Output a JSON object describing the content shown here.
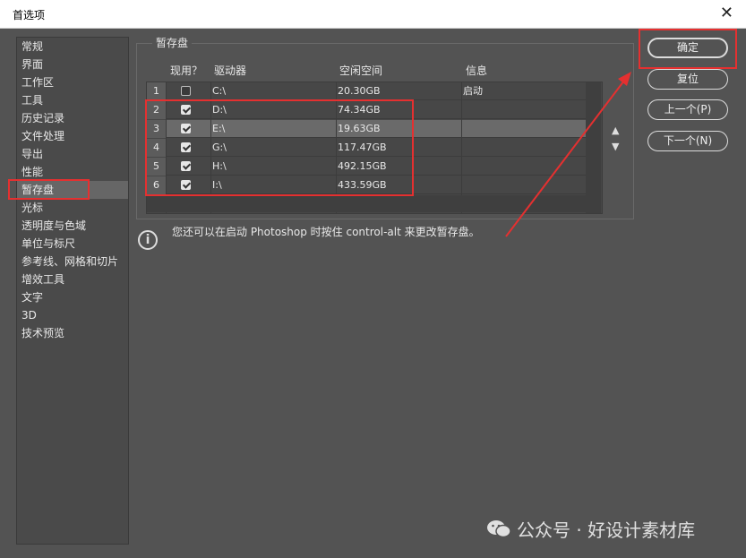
{
  "window": {
    "title": "首选项"
  },
  "sidebar": {
    "items": [
      {
        "label": "常规"
      },
      {
        "label": "界面"
      },
      {
        "label": "工作区"
      },
      {
        "label": "工具"
      },
      {
        "label": "历史记录"
      },
      {
        "label": "文件处理"
      },
      {
        "label": "导出"
      },
      {
        "label": "性能"
      },
      {
        "label": "暂存盘",
        "active": true
      },
      {
        "label": "光标"
      },
      {
        "label": "透明度与色域"
      },
      {
        "label": "单位与标尺"
      },
      {
        "label": "参考线、网格和切片"
      },
      {
        "label": "增效工具"
      },
      {
        "label": "文字"
      },
      {
        "label": "3D"
      },
      {
        "label": "技术预览"
      }
    ]
  },
  "scratch": {
    "group_title": "暂存盘",
    "columns": {
      "active": "现用？",
      "drive": "驱动器",
      "free": "空闲空间",
      "info": "信息"
    },
    "rows": [
      {
        "num": "1",
        "checked": false,
        "drive": "C:\\",
        "free": "20.30GB",
        "info": "启动"
      },
      {
        "num": "2",
        "checked": true,
        "drive": "D:\\",
        "free": "74.34GB",
        "info": ""
      },
      {
        "num": "3",
        "checked": true,
        "drive": "E:\\",
        "free": "19.63GB",
        "info": ""
      },
      {
        "num": "4",
        "checked": true,
        "drive": "G:\\",
        "free": "117.47GB",
        "info": ""
      },
      {
        "num": "5",
        "checked": true,
        "drive": "H:\\",
        "free": "492.15GB",
        "info": ""
      },
      {
        "num": "6",
        "checked": true,
        "drive": "I:\\",
        "free": "433.59GB",
        "info": ""
      }
    ],
    "selected_row": "3",
    "move_up_symbol": "▲",
    "move_down_symbol": "▼",
    "info_icon_glyph": "i",
    "info_text": "您还可以在启动 Photoshop 时按住 control-alt 来更改暂存盘。"
  },
  "buttons": {
    "ok": "确定",
    "reset": "复位",
    "prev": "上一个(P)",
    "next": "下一个(N)"
  },
  "watermark": {
    "text": "公众号 · 好设计素材库"
  },
  "colors": {
    "annotation": "#e53030",
    "dialog_bg": "#535353",
    "selected_row": "#6a6a6a"
  }
}
